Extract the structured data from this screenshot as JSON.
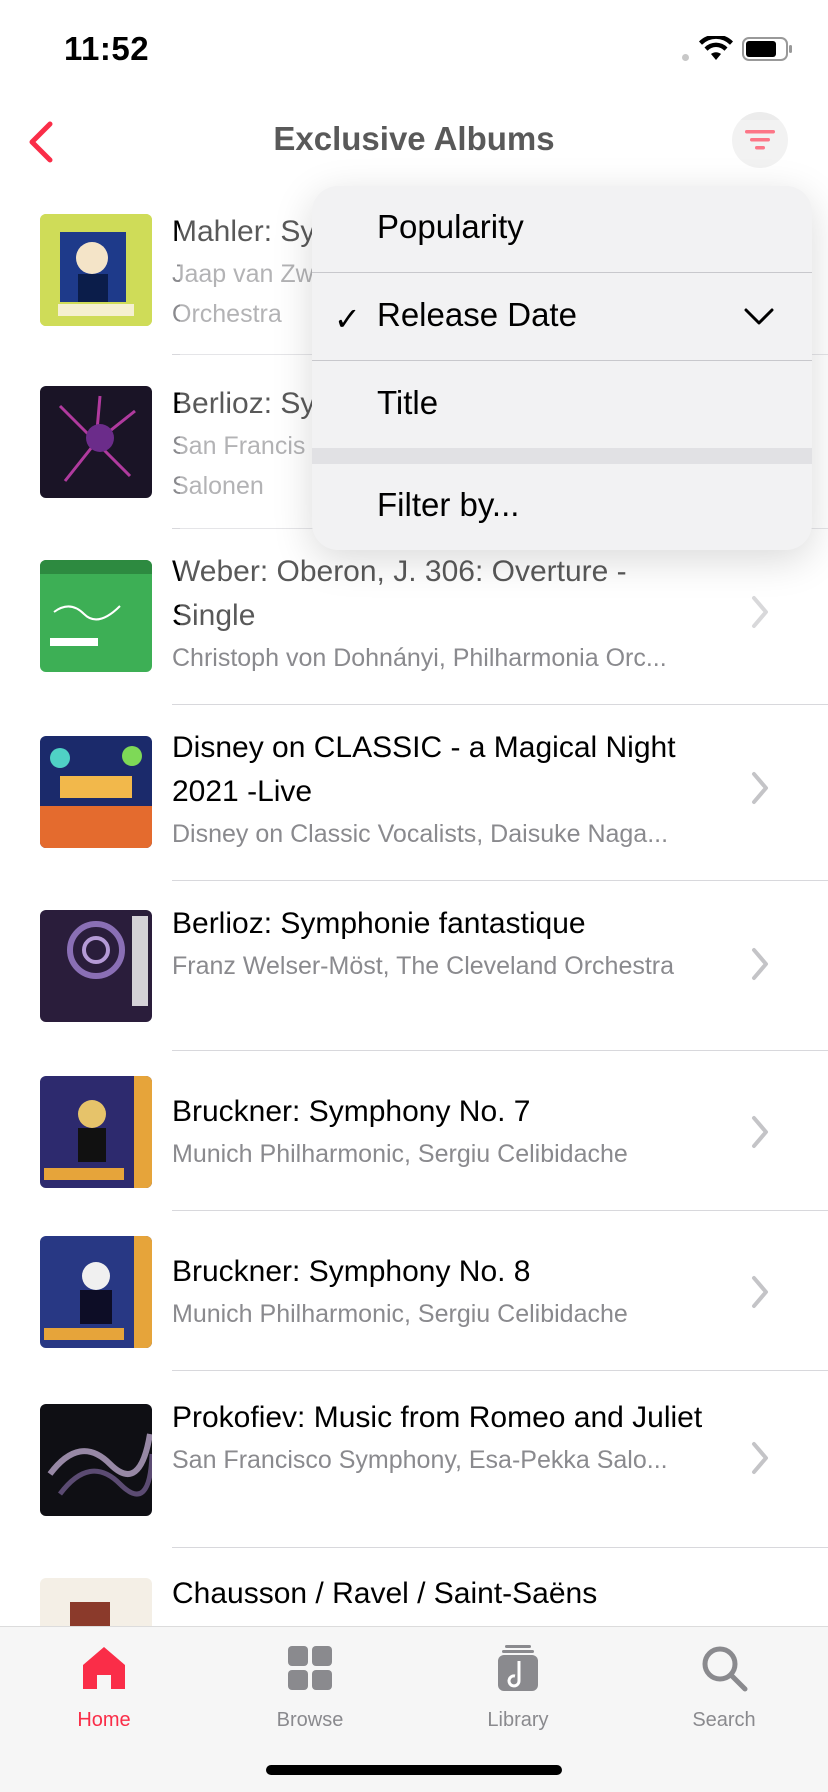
{
  "status_bar": {
    "time": "11:52"
  },
  "nav": {
    "title": "Exclusive Albums"
  },
  "accent_color": "#fa2d48",
  "albums": [
    {
      "title": "Mahler: Sy",
      "artist": "Jaap van Zw… Orchestra",
      "artist_line1": "Jaap van Zw",
      "artist_line2": "Orchestra"
    },
    {
      "title": "Berlioz: Sy",
      "artist_line1": "San Francis",
      "artist_line2": "Salonen"
    },
    {
      "title": "Weber: Oberon, J. 306: Overture - Single",
      "artist": "Christoph von Dohnányi, Philharmonia Orc..."
    },
    {
      "title": "Disney on CLASSIC - a Magical Night 2021 -Live",
      "artist": "Disney on Classic Vocalists, Daisuke Naga..."
    },
    {
      "title": "Berlioz: Symphonie fantastique",
      "artist": "Franz Welser-Möst, The Cleveland Orchestra"
    },
    {
      "title": "Bruckner: Symphony No. 7",
      "artist": "Munich Philharmonic, Sergiu Celibidache"
    },
    {
      "title": "Bruckner: Symphony No. 8",
      "artist": "Munich Philharmonic, Sergiu Celibidache"
    },
    {
      "title": "Prokofiev: Music from Romeo and Juliet",
      "artist": "San Francisco Symphony, Esa-Pekka Salo..."
    },
    {
      "title": "Chausson / Ravel / Saint-Saëns",
      "artist": ""
    }
  ],
  "sort_menu": {
    "items": [
      {
        "label": "Popularity",
        "selected": false
      },
      {
        "label": "Release Date",
        "selected": true,
        "check": "✓"
      },
      {
        "label": "Title",
        "selected": false
      }
    ],
    "filter_label": "Filter by..."
  },
  "tabs": [
    {
      "label": "Home",
      "icon": "home-icon",
      "active": true
    },
    {
      "label": "Browse",
      "icon": "browse-grid-icon",
      "active": false
    },
    {
      "label": "Library",
      "icon": "library-icon",
      "active": false
    },
    {
      "label": "Search",
      "icon": "search-icon",
      "active": false
    }
  ]
}
